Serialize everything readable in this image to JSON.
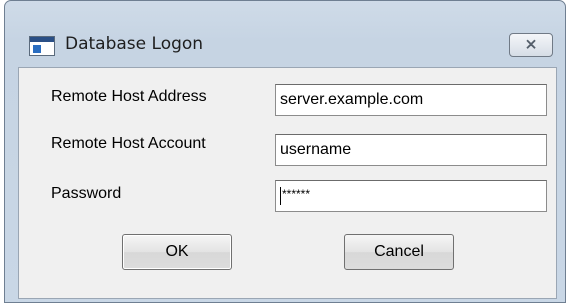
{
  "window": {
    "title": "Database Logon",
    "close_glyph": "⨯",
    "icon": "application-window-icon"
  },
  "form": {
    "host_address": {
      "label": "Remote Host Address",
      "value": "server.example.com"
    },
    "host_account": {
      "label": "Remote Host Account",
      "value": "username"
    },
    "password": {
      "label": "Password",
      "value": "******"
    }
  },
  "buttons": {
    "ok_label": "OK",
    "cancel_label": "Cancel"
  }
}
